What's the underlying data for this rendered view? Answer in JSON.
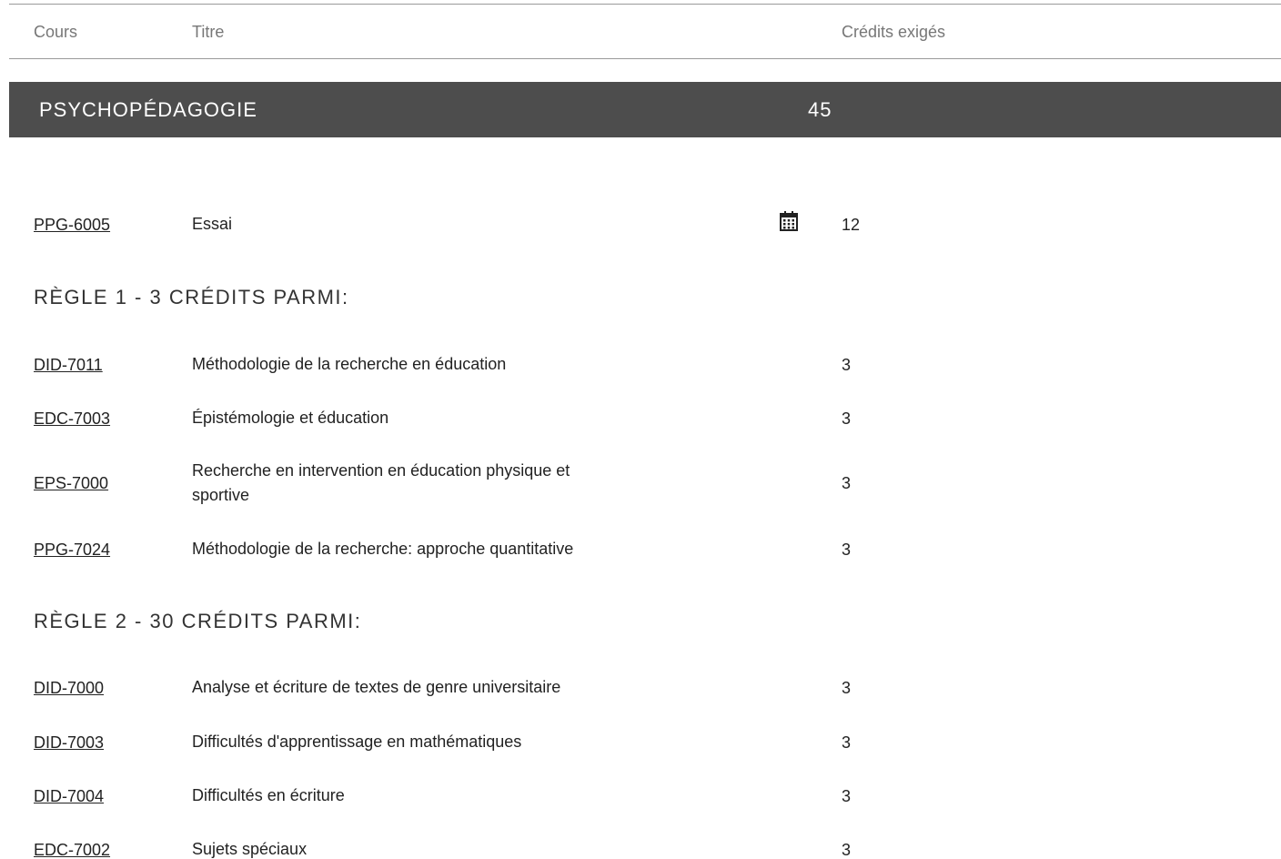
{
  "header": {
    "col_cours": "Cours",
    "col_titre": "Titre",
    "col_credits": "Crédits exigés"
  },
  "section": {
    "title": "PSYCHOPÉDAGOGIE",
    "credits": "45"
  },
  "essai": {
    "code": "PPG-6005",
    "title": "Essai",
    "credits": "12",
    "icon": "calendar-icon"
  },
  "rule1": {
    "heading": "RÈGLE 1 - 3 CRÉDITS PARMI:",
    "courses": [
      {
        "code": "DID-7011",
        "title": "Méthodologie de la recherche en éducation",
        "credits": "3"
      },
      {
        "code": "EDC-7003",
        "title": "Épistémologie et éducation",
        "credits": "3"
      },
      {
        "code": "EPS-7000",
        "title": "Recherche en intervention en éducation physique et sportive",
        "credits": "3"
      },
      {
        "code": "PPG-7024",
        "title": "Méthodologie de la recherche: approche quantitative",
        "credits": "3"
      }
    ]
  },
  "rule2": {
    "heading": "RÈGLE 2 - 30 CRÉDITS PARMI:",
    "courses": [
      {
        "code": "DID-7000",
        "title": "Analyse et écriture de textes de genre universitaire",
        "credits": "3"
      },
      {
        "code": "DID-7003",
        "title": "Difficultés d'apprentissage en mathématiques",
        "credits": "3"
      },
      {
        "code": "DID-7004",
        "title": "Difficultés en écriture",
        "credits": "3"
      },
      {
        "code": "EDC-7002",
        "title": "Sujets spéciaux",
        "credits": "3"
      }
    ]
  }
}
